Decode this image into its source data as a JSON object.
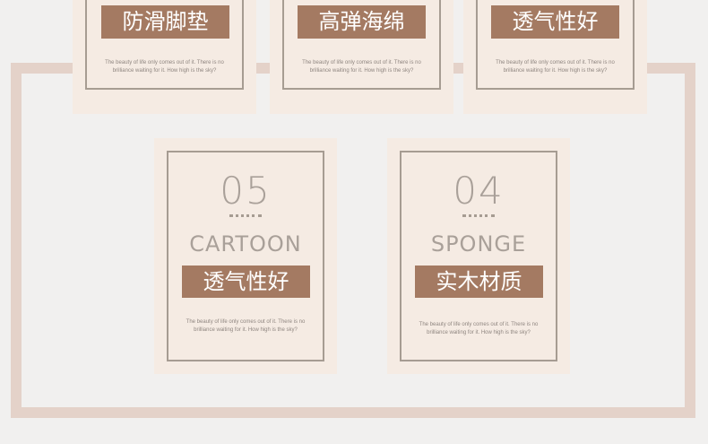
{
  "top_cards": [
    {
      "label": "防滑脚垫",
      "desc_line1": "The beauty of life only comes out of it. There is no",
      "desc_line2": "brilliance waiting for it. How high is the sky?"
    },
    {
      "label": "高弹海绵",
      "desc_line1": "The beauty of life only comes out of it. There is no",
      "desc_line2": "brilliance waiting for it. How high is the sky?"
    },
    {
      "label": "透气性好",
      "desc_line1": "The beauty of life only comes out of it. There is no",
      "desc_line2": "brilliance waiting for it. How high is the sky?"
    }
  ],
  "bottom_cards": [
    {
      "number": "05",
      "word": "CARTOON",
      "label": "透气性好",
      "desc_line1": "The beauty of life only comes out of it. There is no",
      "desc_line2": "brilliance waiting for it. How high is the sky?"
    },
    {
      "number": "04",
      "word": "SPONGE",
      "label": "实木材质",
      "desc_line1": "The beauty of life only comes out of it. There is no",
      "desc_line2": "brilliance waiting for it. How high is the sky?"
    }
  ],
  "colors": {
    "background": "#f1f0ef",
    "frame": "#e4d2c9",
    "card": "#f5ebe3",
    "tag": "#a47a62",
    "muted_text": "#a9a099"
  }
}
